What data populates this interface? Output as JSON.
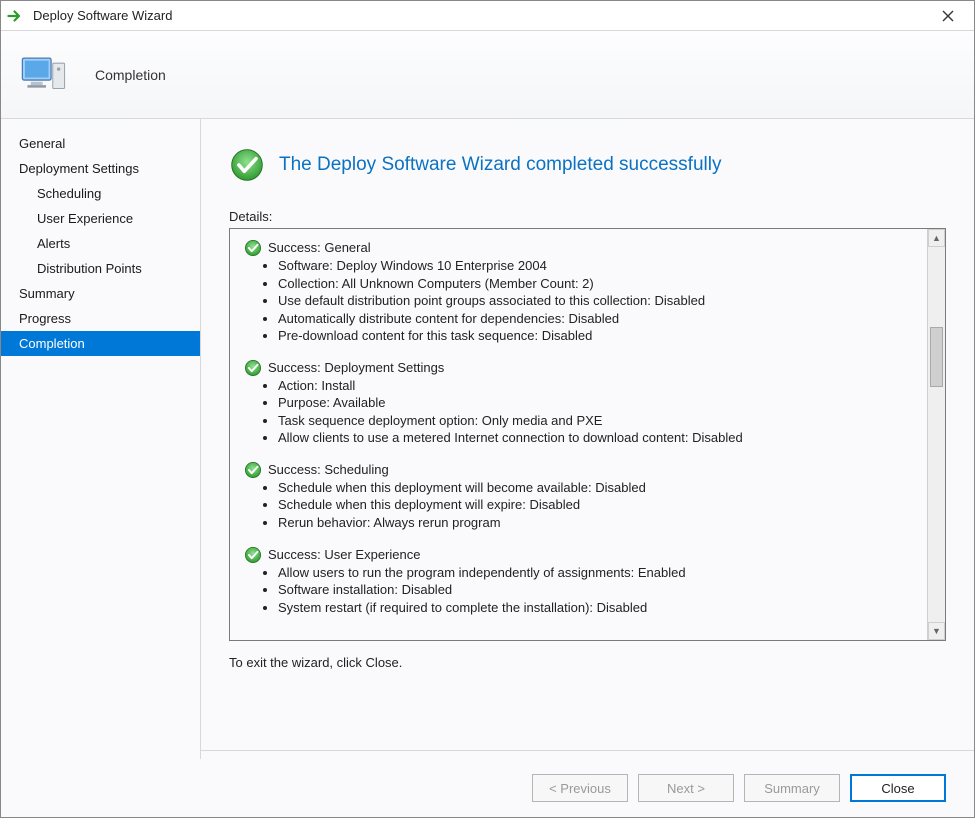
{
  "window": {
    "title": "Deploy Software Wizard"
  },
  "header": {
    "title": "Completion"
  },
  "sidebar": {
    "items": [
      {
        "label": "General",
        "sub": false,
        "selected": false
      },
      {
        "label": "Deployment Settings",
        "sub": false,
        "selected": false
      },
      {
        "label": "Scheduling",
        "sub": true,
        "selected": false
      },
      {
        "label": "User Experience",
        "sub": true,
        "selected": false
      },
      {
        "label": "Alerts",
        "sub": true,
        "selected": false
      },
      {
        "label": "Distribution Points",
        "sub": true,
        "selected": false
      },
      {
        "label": "Summary",
        "sub": false,
        "selected": false
      },
      {
        "label": "Progress",
        "sub": false,
        "selected": false
      },
      {
        "label": "Completion",
        "sub": false,
        "selected": true
      }
    ]
  },
  "main": {
    "success_message": "The Deploy Software Wizard completed successfully",
    "details_label": "Details:",
    "exit_note": "To exit the wizard, click Close.",
    "groups": [
      {
        "title": "Success: General",
        "lines": [
          "Software: Deploy Windows 10 Enterprise 2004",
          "Collection: All Unknown Computers (Member Count: 2)",
          "Use default distribution point groups associated to this collection: Disabled",
          "Automatically distribute content for dependencies: Disabled",
          "Pre-download content for this task sequence: Disabled"
        ]
      },
      {
        "title": "Success: Deployment Settings",
        "lines": [
          "Action: Install",
          "Purpose: Available",
          "Task sequence deployment option: Only media and PXE",
          "Allow clients to use a metered Internet connection to download content: Disabled"
        ]
      },
      {
        "title": "Success: Scheduling",
        "lines": [
          "Schedule when this deployment will become available: Disabled",
          "Schedule when this deployment will expire: Disabled",
          "Rerun behavior: Always rerun program"
        ]
      },
      {
        "title": "Success: User Experience",
        "lines": [
          "Allow users to run the program independently of assignments: Enabled",
          "Software installation: Disabled",
          "System restart (if required to complete the installation): Disabled"
        ]
      }
    ]
  },
  "footer": {
    "previous": "< Previous",
    "next": "Next >",
    "summary": "Summary",
    "close": "Close"
  }
}
